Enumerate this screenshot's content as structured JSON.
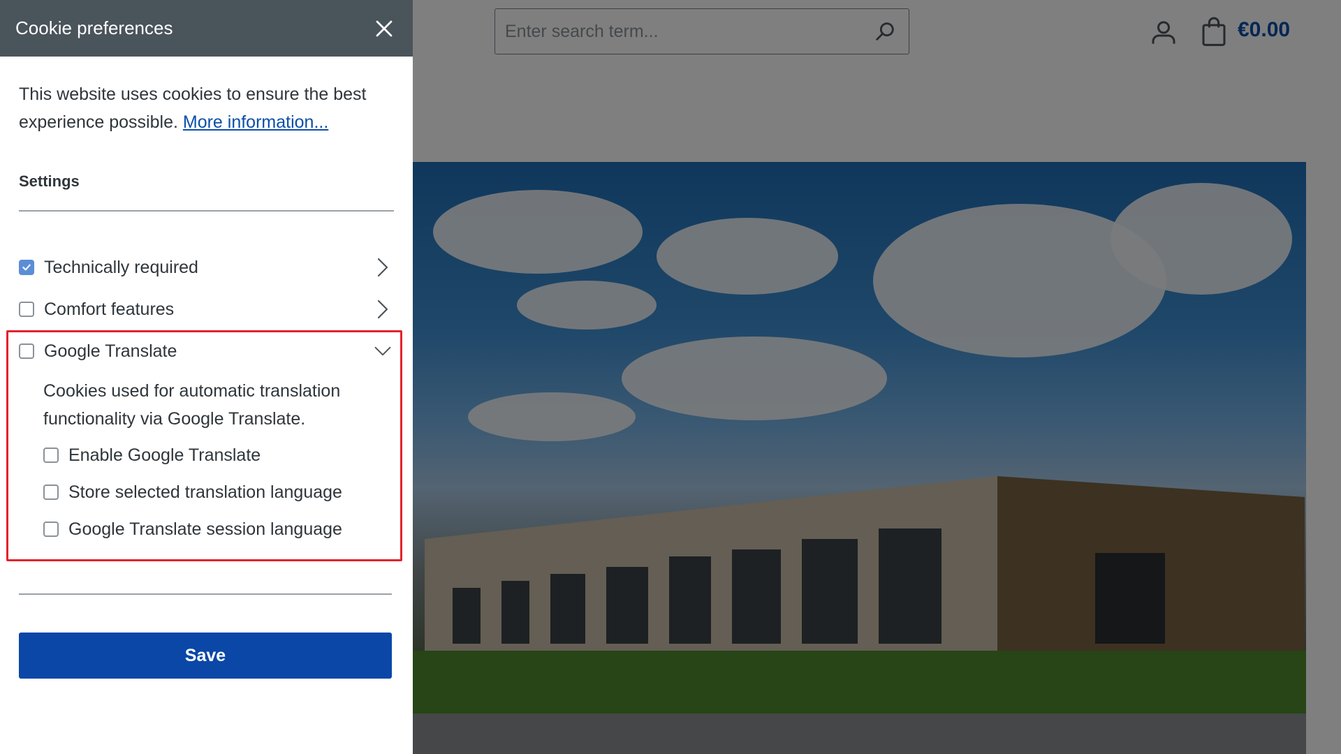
{
  "header": {
    "search": {
      "placeholder": "Enter search term..."
    },
    "cart": {
      "price": "€0.00"
    },
    "icons": {
      "search": "search-icon",
      "account": "user-icon",
      "cart": "bag-icon"
    }
  },
  "cookie_panel": {
    "title": "Cookie preferences",
    "intro_text": "This website uses cookies to ensure the best experience possible.",
    "more_info_link": "More information...",
    "settings_heading": "Settings",
    "categories": [
      {
        "label": "Technically required",
        "checked": true,
        "expanded": false
      },
      {
        "label": "Comfort features",
        "checked": false,
        "expanded": false
      },
      {
        "label": "Google Translate",
        "checked": false,
        "expanded": true,
        "description": "Cookies used for automatic translation functionality via Google Translate.",
        "options": [
          {
            "label": "Enable Google Translate",
            "checked": false
          },
          {
            "label": "Store selected translation language",
            "checked": false
          },
          {
            "label": "Google Translate session language",
            "checked": false
          }
        ]
      }
    ],
    "save_label": "Save"
  },
  "colors": {
    "panel_header": "#4a545b",
    "accent": "#0a47a7",
    "link": "#0b4fa8",
    "checkbox_checked": "#5b8ed6",
    "highlight": "#e3232b"
  }
}
